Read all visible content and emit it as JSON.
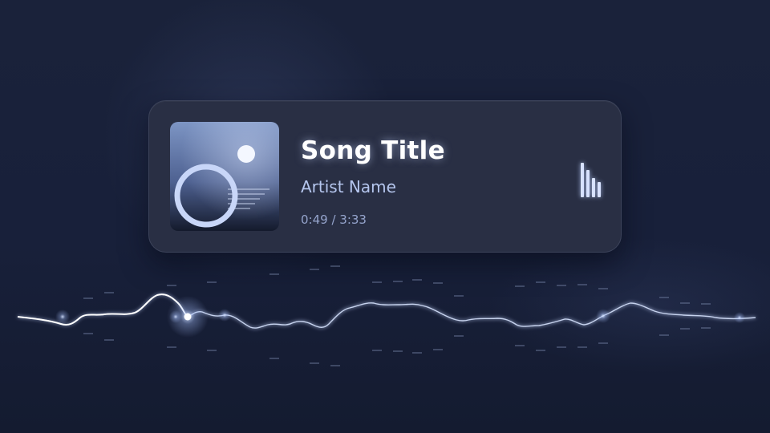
{
  "player": {
    "title": "Song Title",
    "artist": "Artist Name",
    "time": "0:49 / 3:33",
    "elapsed_seconds": 49,
    "duration_seconds": 213
  },
  "album_art": {
    "icon": "album-art-icon"
  },
  "equalizer": {
    "icon": "equalizer-icon",
    "levels": [
      0.9,
      0.7,
      0.5,
      0.4
    ]
  },
  "waveform": {
    "icon": "waveform-visualizer"
  },
  "colors": {
    "background": "#161d33",
    "card": "#292f44",
    "title": "#ffffff",
    "artist": "#b5c6ee",
    "time": "#95a4cc",
    "glow": "#d8e2ff"
  }
}
